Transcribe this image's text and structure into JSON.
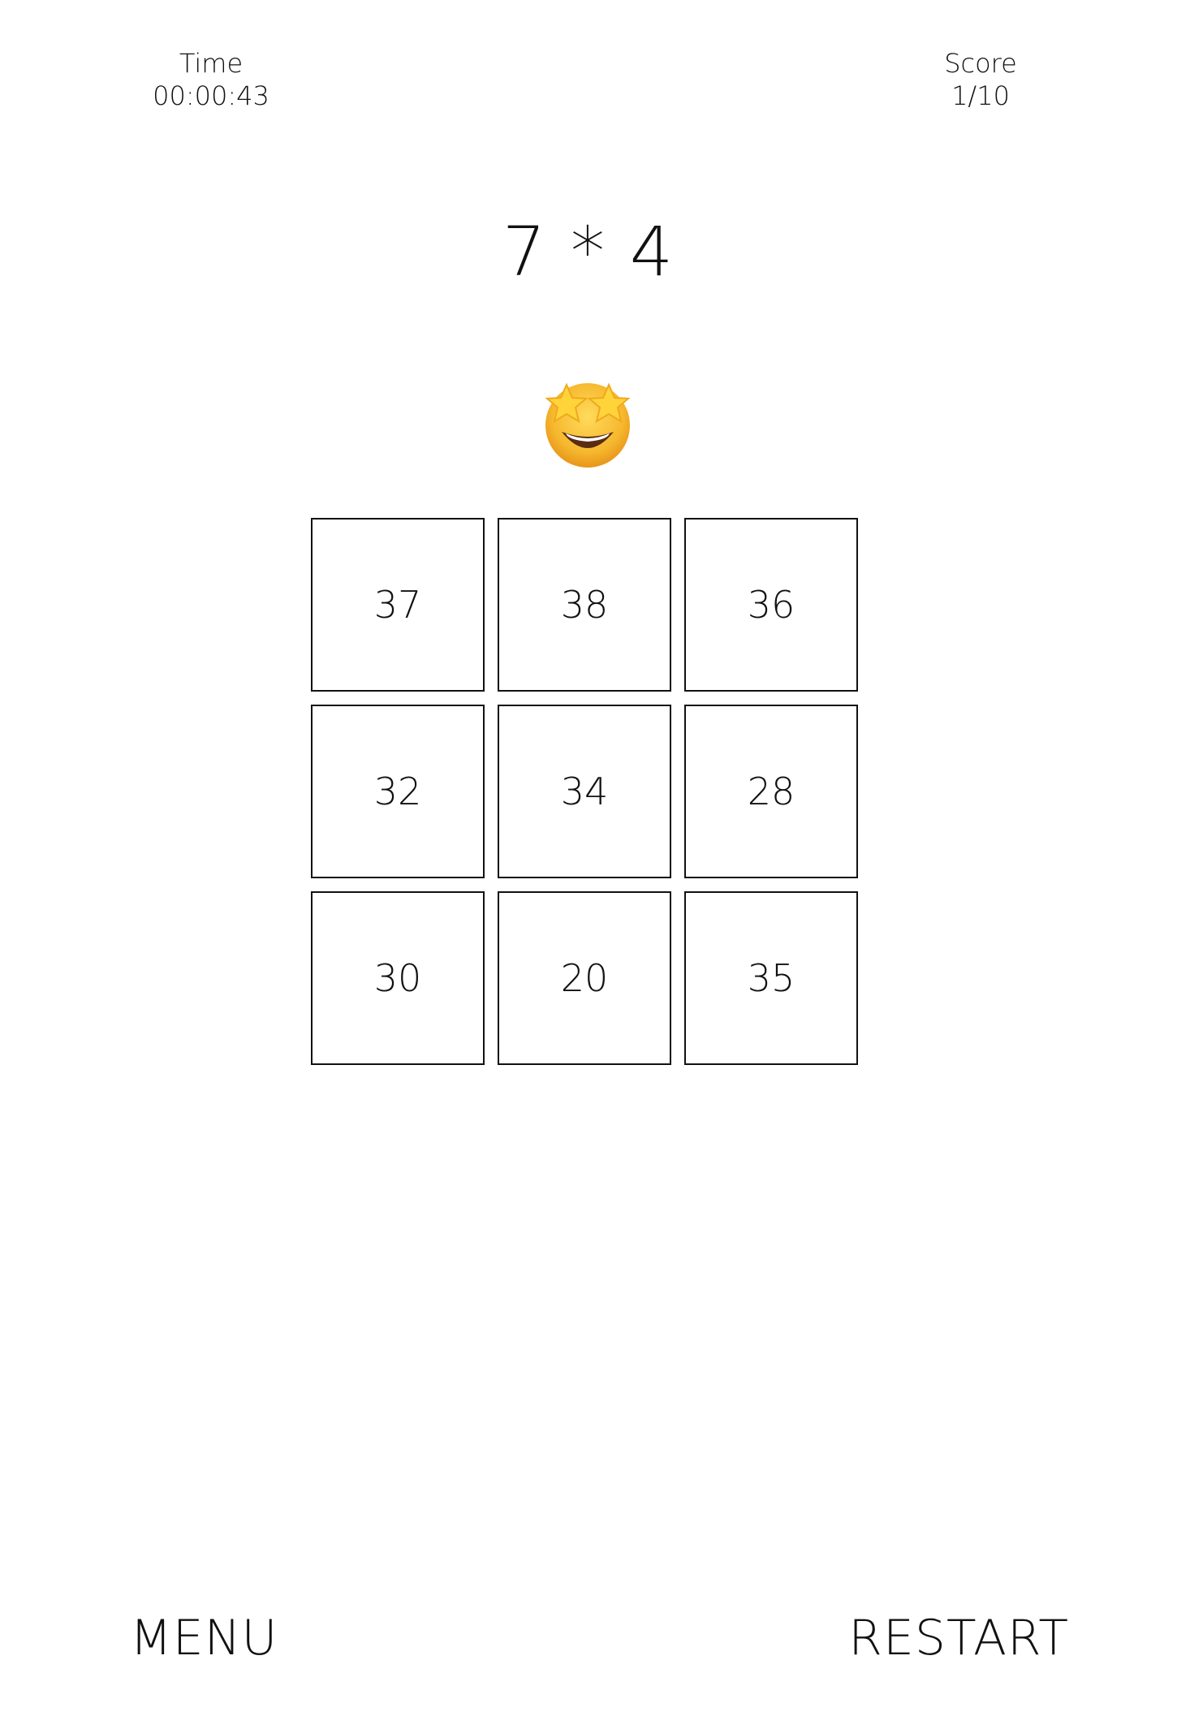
{
  "hud": {
    "time_label": "Time",
    "time_value": "00:00:43",
    "score_label": "Score",
    "score_value": "1/10"
  },
  "question": "7 * 4",
  "feedback_emoji": "star-struck-emoji",
  "answers": [
    "37",
    "38",
    "36",
    "32",
    "34",
    "28",
    "30",
    "20",
    "35"
  ],
  "buttons": {
    "menu": "MENU",
    "restart": "RESTART"
  },
  "colors": {
    "text": "#111111",
    "background": "#ffffff",
    "emoji_face": "#F6B82E",
    "emoji_star": "#FFD43A"
  }
}
